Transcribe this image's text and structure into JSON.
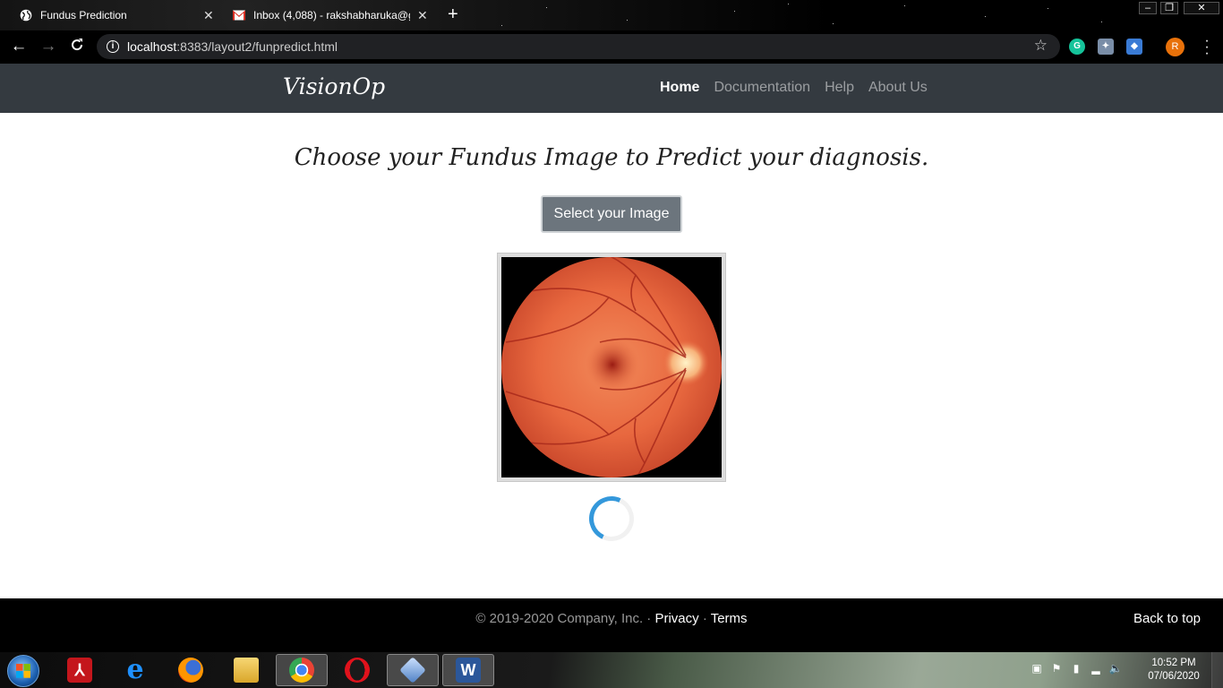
{
  "browser": {
    "tabs": [
      {
        "title": "Fundus Prediction",
        "active": true
      },
      {
        "title": "Inbox (4,088) - rakshabharuka@g",
        "active": false
      }
    ],
    "url_host": "localhost",
    "url_rest": ":8383/layout2/funpredict.html",
    "avatar_letter": "R",
    "extensions": [
      "grammarly-icon",
      "puzzle-extension-icon",
      "cube-extension-icon"
    ]
  },
  "site": {
    "brand": "VisionOp",
    "nav": [
      {
        "label": "Home",
        "active": true
      },
      {
        "label": "Documentation",
        "active": false
      },
      {
        "label": "Help",
        "active": false
      },
      {
        "label": "About Us",
        "active": false
      }
    ],
    "heading": "Choose your Fundus Image to Predict your diagnosis.",
    "select_button": "Select your Image",
    "loading": true
  },
  "footer": {
    "copyright": "© 2019-2020 Company, Inc. · ",
    "privacy": "Privacy",
    "separator": " · ",
    "terms": "Terms",
    "back_to_top": "Back to top"
  },
  "taskbar": {
    "apps": [
      "adobe-acrobat-icon",
      "internet-explorer-icon",
      "firefox-icon",
      "file-explorer-icon",
      "chrome-icon",
      "opera-icon",
      "virtualbox-icon",
      "word-icon"
    ],
    "active_app": "chrome-icon",
    "time": "10:52 PM",
    "date": "07/06/2020"
  },
  "colors": {
    "navbar": "#343a40",
    "button": "#6c757d",
    "spinner": "#3498db",
    "footer": "#000000"
  }
}
